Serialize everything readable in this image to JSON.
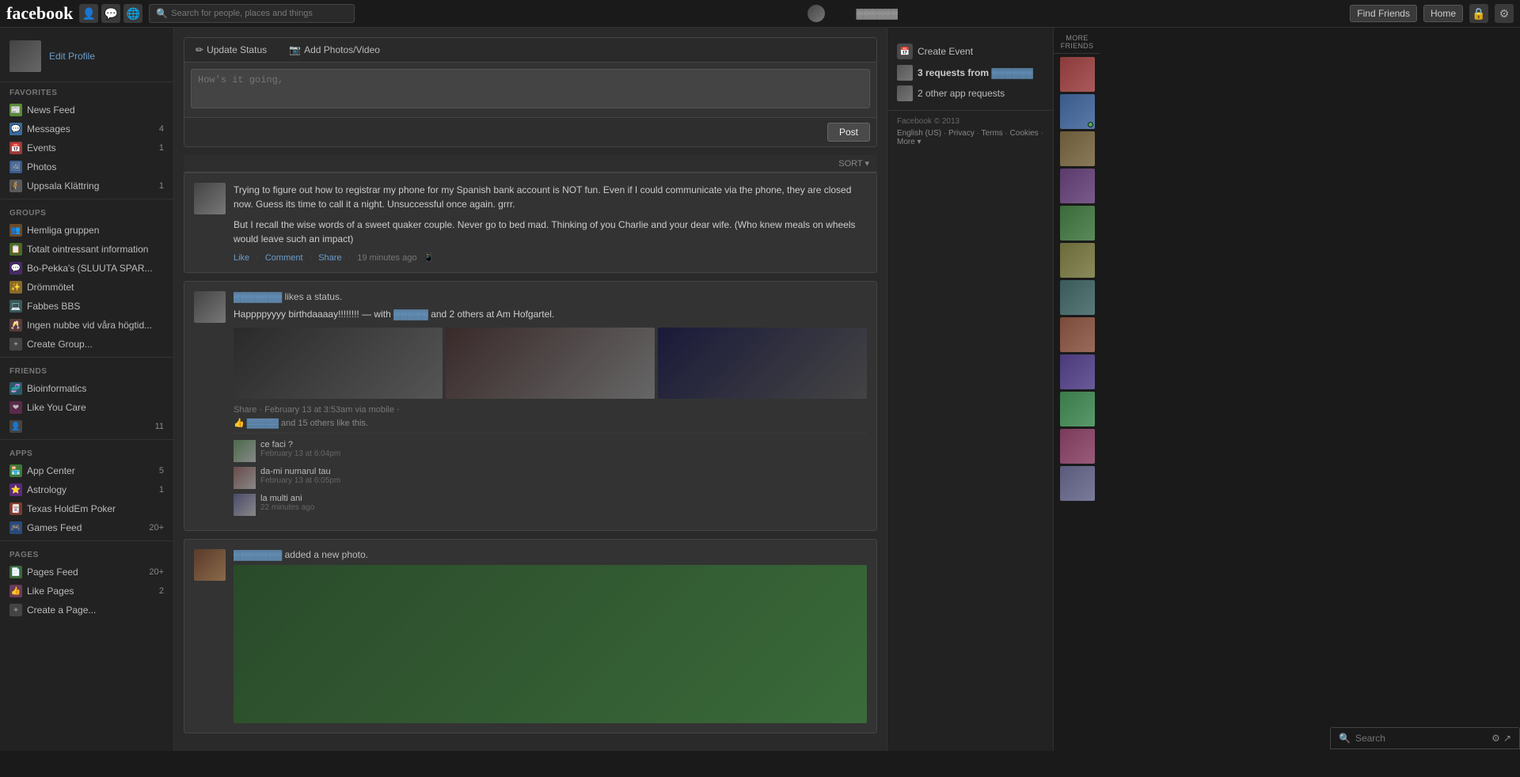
{
  "nav": {
    "logo": "facebook",
    "search_placeholder": "Search for people, places and things",
    "find_friends": "Find Friends",
    "home": "Home",
    "icons": [
      "👤",
      "💬",
      "🌐"
    ]
  },
  "sidebar": {
    "profile": {
      "edit_label": "Edit Profile"
    },
    "favorites_title": "FAVORITES",
    "favorites": [
      {
        "id": "news-feed",
        "label": "News Feed",
        "count": ""
      },
      {
        "id": "messages",
        "label": "Messages",
        "count": "4"
      },
      {
        "id": "events",
        "label": "Events",
        "count": "1"
      },
      {
        "id": "photos",
        "label": "Photos",
        "count": ""
      },
      {
        "id": "uppsala",
        "label": "Uppsala Klättring",
        "count": "1"
      }
    ],
    "groups_title": "GROUPS",
    "groups": [
      {
        "id": "hemliga",
        "label": "Hemliga gruppen",
        "count": ""
      },
      {
        "id": "totalt",
        "label": "Totalt ointressant information",
        "count": ""
      },
      {
        "id": "bopekka",
        "label": "Bo-Pekka's (SLUUTA SPAR...",
        "count": ""
      },
      {
        "id": "drommötet",
        "label": "Drömmötet",
        "count": ""
      },
      {
        "id": "fabbes",
        "label": "Fabbes BBS",
        "count": ""
      },
      {
        "id": "ingen",
        "label": "Ingen nubbe vid våra högtid...",
        "count": ""
      },
      {
        "id": "create-group",
        "label": "Create Group...",
        "count": ""
      }
    ],
    "friends_title": "FRIENDS",
    "friends": [
      {
        "id": "bioinformatics",
        "label": "Bioinformatics",
        "count": ""
      },
      {
        "id": "like-you-care",
        "label": "Like You Care",
        "count": ""
      },
      {
        "id": "friend-3",
        "label": "",
        "count": "11"
      }
    ],
    "apps_title": "APPS",
    "apps": [
      {
        "id": "app-center",
        "label": "App Center",
        "count": "5"
      },
      {
        "id": "astrology",
        "label": "Astrology",
        "count": "1"
      },
      {
        "id": "texas-holdem",
        "label": "Texas HoldEm Poker",
        "count": ""
      },
      {
        "id": "games-feed",
        "label": "Games Feed",
        "count": "20+"
      }
    ],
    "pages_title": "PAGES",
    "pages": [
      {
        "id": "pages-feed",
        "label": "Pages Feed",
        "count": "20+"
      },
      {
        "id": "like-pages",
        "label": "Like Pages",
        "count": "2"
      },
      {
        "id": "create-page",
        "label": "Create a Page...",
        "count": ""
      }
    ]
  },
  "status_box": {
    "tab1": "Update Status",
    "tab2": "Add Photos/Video",
    "placeholder": "How's it going,",
    "post_label": "Post"
  },
  "sort_label": "SORT ▾",
  "posts": [
    {
      "id": "post-1",
      "text": "Trying to figure out how to registrar my phone for my Spanish bank account is NOT fun. Even if I could communicate via the phone, they are closed now. Guess its time to call it a night. Unsuccessful once again. grrr.\n\nBut I recall the wise words of a sweet quaker couple. Never go to bed mad. Thinking of you Charlie and your dear wife. (Who knew meals on wheels would leave such an impact)",
      "actions": [
        "Like",
        "Comment",
        "Share"
      ],
      "time": "19 minutes ago"
    },
    {
      "id": "post-2",
      "header": "likes a status.",
      "birthday_text": "Happppyyyy birthdaaaay!!!!!!!! — with",
      "birthday_suffix": "and 2 others at Am Hofgartel.",
      "meta": "Share · February 13 at 3:53am via mobile ·",
      "likes_text": "and 15 others like this.",
      "comments": [
        {
          "text": "ce faci ?",
          "time": "February 13 at 6:04pm"
        },
        {
          "text": "da-mi numarul tau",
          "time": "February 13 at 6:05pm"
        },
        {
          "text": "la multi ani",
          "time": "22 minutes ago"
        }
      ]
    },
    {
      "id": "post-3",
      "header": "added a new photo."
    }
  ],
  "right_panel": {
    "create_event_label": "Create Event",
    "requests": [
      {
        "label": "3 requests from",
        "sub": ""
      },
      {
        "label": "2 other app requests",
        "sub": ""
      }
    ],
    "footer": {
      "copyright": "Facebook © 2013",
      "links": [
        "English (US)",
        "Privacy",
        "Terms",
        "Cookies",
        "More"
      ]
    }
  },
  "friends_strip": {
    "title": "MORE FRIENDS",
    "avatars": [
      1,
      2,
      3,
      4,
      5,
      6,
      7,
      8,
      9,
      10,
      11,
      12
    ]
  },
  "bottom_bar": {
    "search_placeholder": "Search",
    "icon1": "⚙",
    "icon2": "↗"
  }
}
